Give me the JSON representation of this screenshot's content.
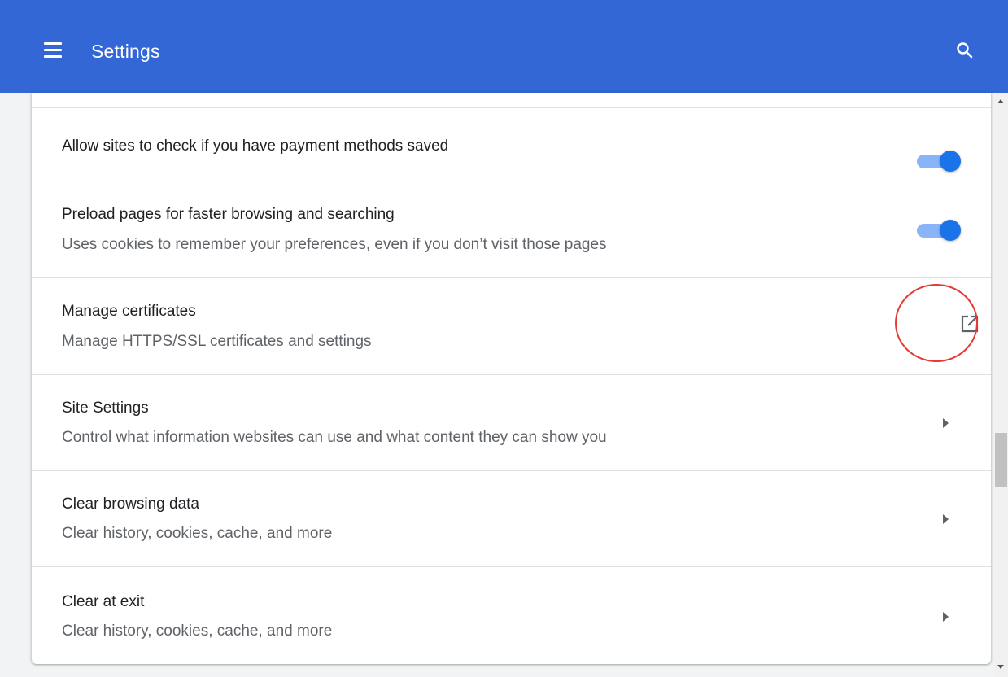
{
  "app_bar": {
    "title": "Settings",
    "menu_icon": "hamburger-menu-icon",
    "search_icon": "search-icon",
    "background_color": "#3367d6"
  },
  "rows": [
    {
      "title": "Allow sites to check if you have payment methods saved",
      "control": "toggle",
      "toggle_on": true
    },
    {
      "title": "Preload pages for faster browsing and searching",
      "subtitle": "Uses cookies to remember your preferences, even if you don’t visit those pages",
      "control": "toggle",
      "toggle_on": true
    },
    {
      "title": "Manage certificates",
      "subtitle": "Manage HTTPS/SSL certificates and settings",
      "control": "open-in-new-icon",
      "highlighted": true
    },
    {
      "title": "Site Settings",
      "subtitle": "Control what information websites can use and what content they can show you",
      "control": "chevron-right-icon"
    },
    {
      "title": "Clear browsing data",
      "subtitle": "Clear history, cookies, cache, and more",
      "control": "chevron-right-icon"
    },
    {
      "title": "Clear at exit",
      "subtitle": "Clear history, cookies, cache, and more",
      "control": "chevron-right-icon"
    }
  ],
  "colors": {
    "accent": "#1a73e8",
    "toggle_track": "#8ab4f8",
    "annotation": "#e53935"
  }
}
